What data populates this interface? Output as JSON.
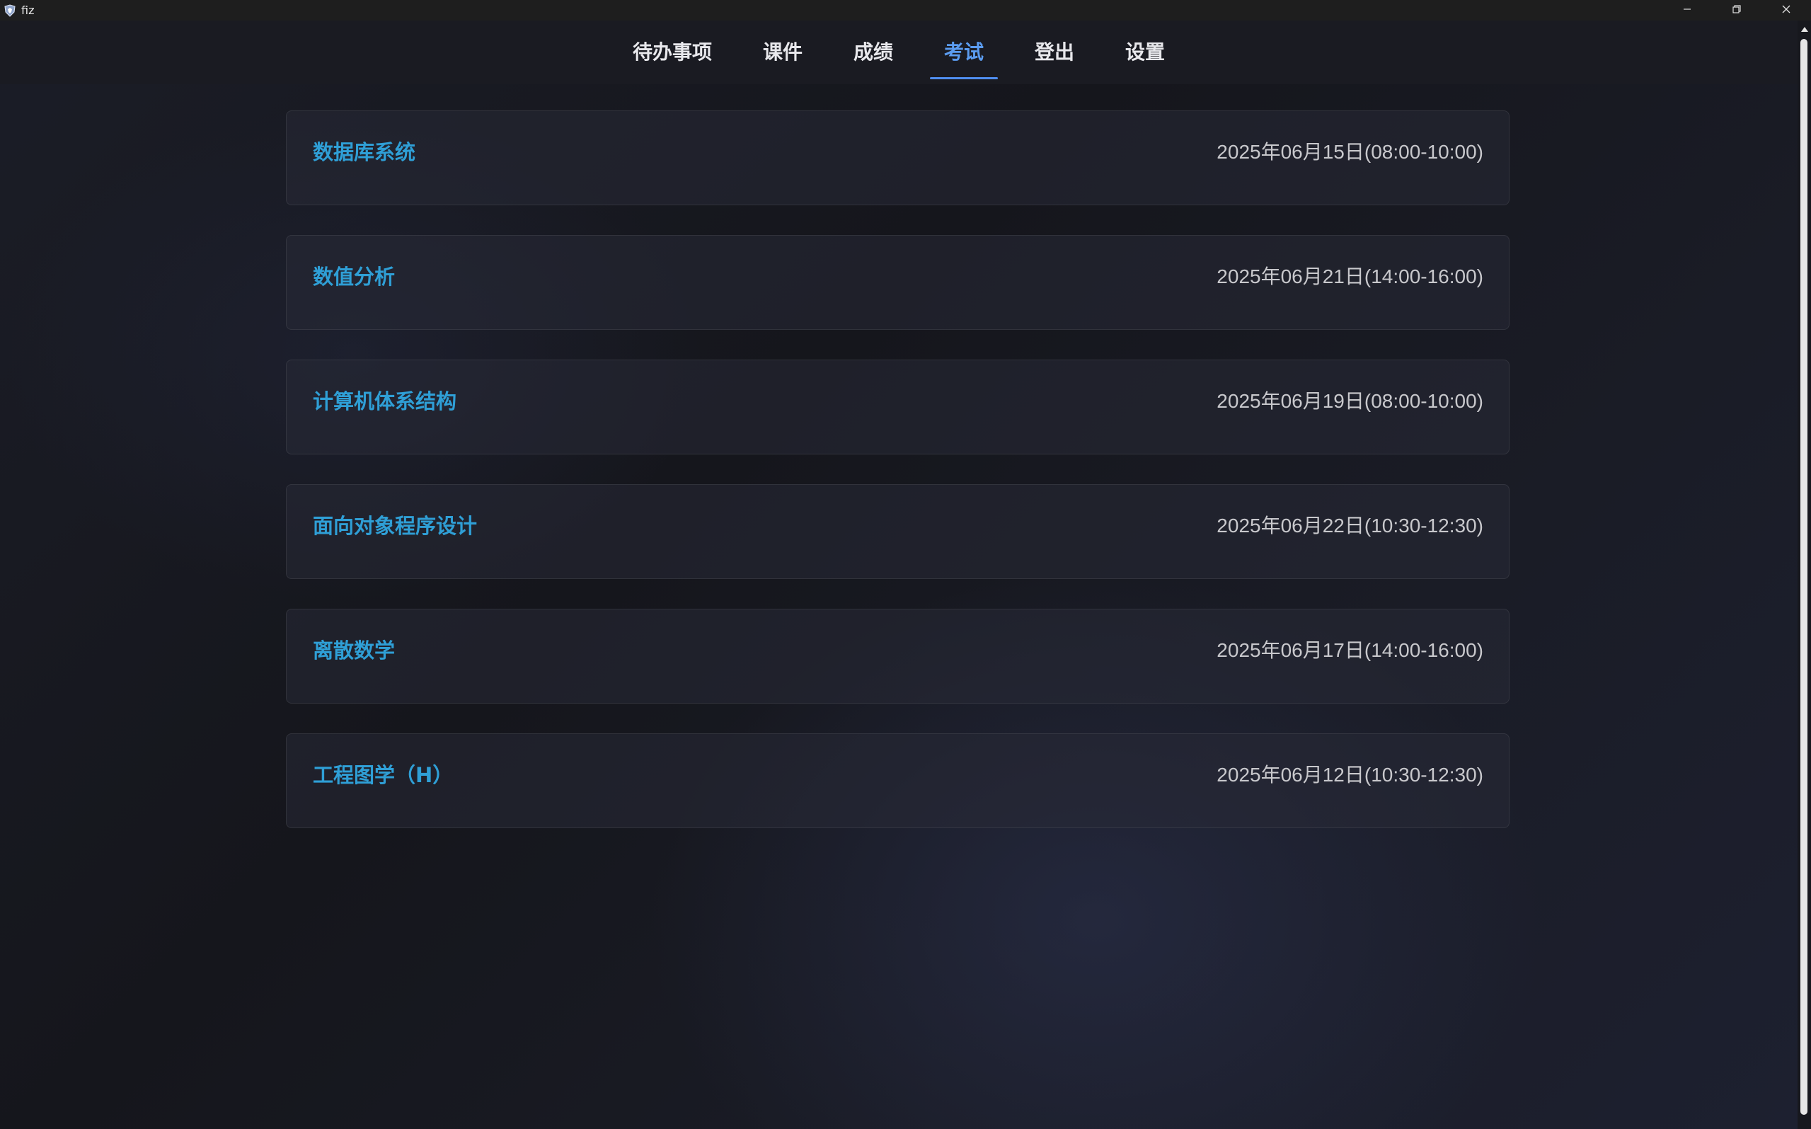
{
  "window": {
    "title": "fiz"
  },
  "nav": {
    "tabs": [
      {
        "label": "待办事项",
        "active": false
      },
      {
        "label": "课件",
        "active": false
      },
      {
        "label": "成绩",
        "active": false
      },
      {
        "label": "考试",
        "active": true
      },
      {
        "label": "登出",
        "active": false
      },
      {
        "label": "设置",
        "active": false
      }
    ]
  },
  "exams": [
    {
      "name": "数据库系统",
      "time": "2025年06月15日(08:00-10:00)"
    },
    {
      "name": "数值分析",
      "time": "2025年06月21日(14:00-16:00)"
    },
    {
      "name": "计算机体系结构",
      "time": "2025年06月19日(08:00-10:00)"
    },
    {
      "name": "面向对象程序设计",
      "time": "2025年06月22日(10:30-12:30)"
    },
    {
      "name": "离散数学",
      "time": "2025年06月17日(14:00-16:00)"
    },
    {
      "name": "工程图学（H）",
      "time": "2025年06月12日(10:30-12:30)"
    }
  ],
  "colors": {
    "accent": "#4f8ef0",
    "exam_name": "#2f9fd6",
    "background": "#16171d"
  },
  "icons": {
    "app": "app-logo-icon",
    "minimize": "minimize-icon",
    "restore": "restore-icon",
    "close": "close-icon",
    "scroll_up": "scroll-up-arrow-icon"
  }
}
